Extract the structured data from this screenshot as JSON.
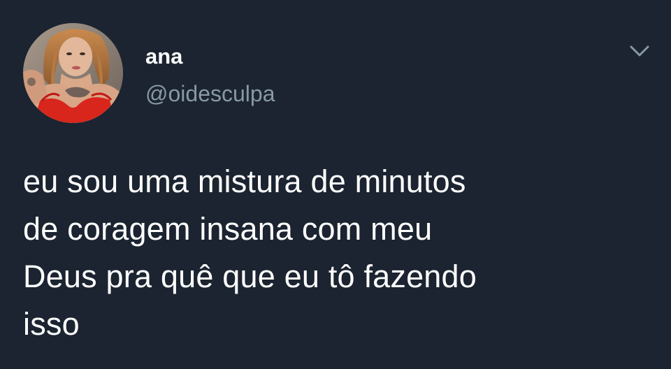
{
  "tweet": {
    "author": {
      "display_name": "ana",
      "handle": "@oidesculpa",
      "avatar": "profile-photo"
    },
    "menu_icon": "chevron-down-icon",
    "text_lines": [
      "eu sou uma mistura de minutos",
      "de coragem insana com meu",
      "Deus pra quê que eu tô fazendo",
      "isso"
    ]
  },
  "colors": {
    "background": "#1b2430",
    "text": "#ffffff",
    "secondary_text": "#8899a6"
  }
}
